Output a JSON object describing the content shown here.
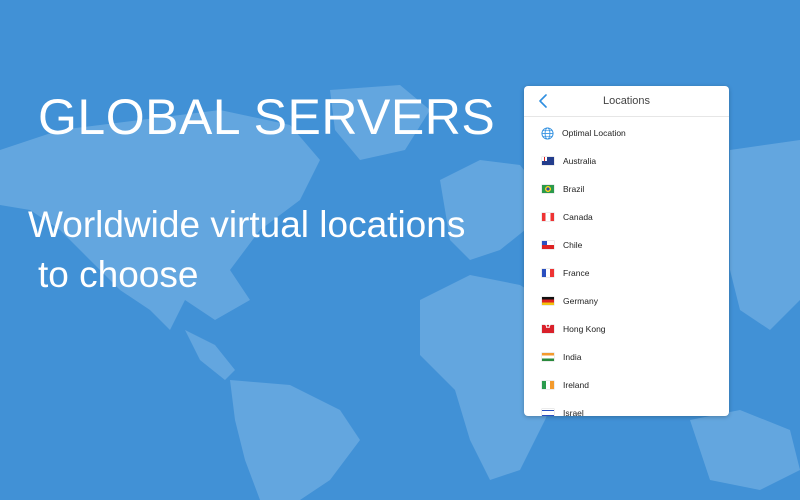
{
  "hero": {
    "headline": "GLOBAL SERVERS",
    "subline_1": "Worldwide virtual locations",
    "subline_2": "to choose"
  },
  "panel": {
    "title": "Locations",
    "items": [
      {
        "label": "Optimal Location",
        "icon": "globe-icon"
      },
      {
        "label": "Australia",
        "icon": "flag-australia"
      },
      {
        "label": "Brazil",
        "icon": "flag-brazil"
      },
      {
        "label": "Canada",
        "icon": "flag-canada"
      },
      {
        "label": "Chile",
        "icon": "flag-chile"
      },
      {
        "label": "France",
        "icon": "flag-france"
      },
      {
        "label": "Germany",
        "icon": "flag-germany"
      },
      {
        "label": "Hong Kong",
        "icon": "flag-hong-kong"
      },
      {
        "label": "India",
        "icon": "flag-india"
      },
      {
        "label": "Ireland",
        "icon": "flag-ireland"
      },
      {
        "label": "Israel",
        "icon": "flag-israel"
      }
    ]
  },
  "colors": {
    "background": "#4191d6",
    "map_land": "#6aa9e0",
    "accent": "#2f8fe0"
  }
}
